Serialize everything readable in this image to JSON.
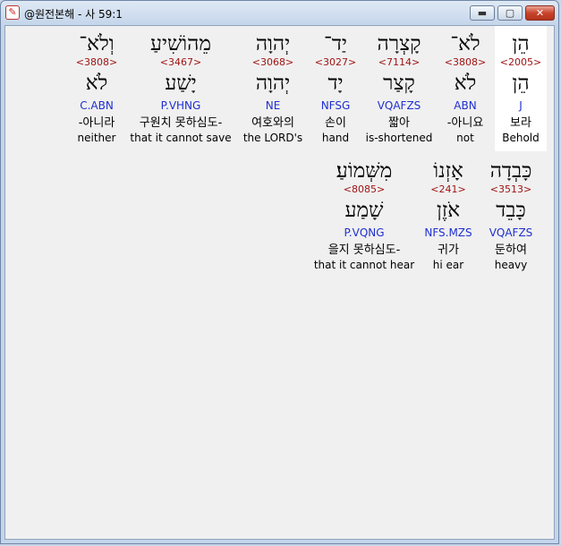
{
  "window": {
    "title": "@원전본해 - 사 59:1",
    "minimize_glyph": "▬",
    "maximize_glyph": "▢",
    "close_glyph": "✕",
    "icon_glyph": "✎"
  },
  "words": [
    {
      "hebrew": "הֵן",
      "strong": "<2005>",
      "lemma": "הֵן",
      "parse": "J",
      "korean": "보라",
      "english": "Behold",
      "active": true
    },
    {
      "hebrew": "לֹא־",
      "strong": "<3808>",
      "lemma": "לֹא",
      "parse": "ABN",
      "korean": "-아니요",
      "english": "not"
    },
    {
      "hebrew": "קָצְרָה",
      "strong": "<7114>",
      "lemma": "קָצַר",
      "parse": "VQAFZS",
      "korean": "짧아",
      "english": "is-shortened"
    },
    {
      "hebrew": "יַד־",
      "strong": "<3027>",
      "lemma": "יָד",
      "parse": "NFSG",
      "korean": "손이",
      "english": "hand"
    },
    {
      "hebrew": "יְהוָה",
      "strong": "<3068>",
      "lemma": "יְהוָה",
      "parse": "NE",
      "korean": "여호와의",
      "english": "the LORD's"
    },
    {
      "hebrew": "מֵהוֹשִׁיעַ",
      "strong": "<3467>",
      "lemma": "יָשַׁע",
      "parse": "P.VHNG",
      "korean": "구원치 못하심도-",
      "english": "that it cannot save"
    },
    {
      "hebrew": "וְלֹא־",
      "strong": "<3808>",
      "lemma": "לֹא",
      "parse": "C.ABN",
      "korean": "-아니라",
      "english": "neither"
    },
    {
      "hebrew": "כָּבְדָה",
      "strong": "<3513>",
      "lemma": "כָּבֵד",
      "parse": "VQAFZS",
      "korean": "둔하여",
      "english": "heavy"
    },
    {
      "hebrew": "אָזְנוֹ",
      "strong": "<241>",
      "lemma": "אֹזֶן",
      "parse": "NFS.MZS",
      "korean": "귀가",
      "english": "hi ear"
    },
    {
      "hebrew": "מִשְּׁמוֹעַ׃",
      "strong": "<8085>",
      "lemma": "שָׁמַע",
      "parse": "P.VQNG",
      "korean": "을지 못하심도-",
      "english": "that it cannot hear"
    }
  ]
}
